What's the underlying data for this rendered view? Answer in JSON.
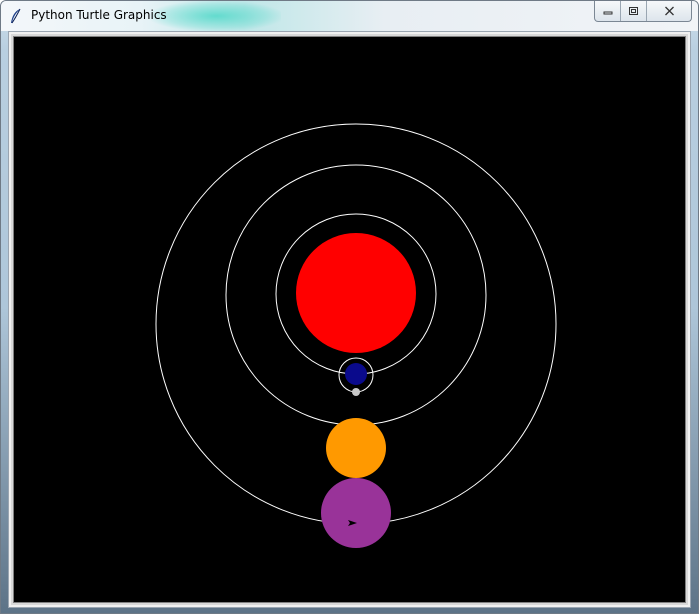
{
  "window": {
    "title": "Python Turtle Graphics",
    "app_icon": "feather-icon",
    "controls": {
      "minimize_icon": "minimize-icon",
      "maximize_icon": "restore-icon",
      "close_icon": "close-icon"
    }
  },
  "canvas": {
    "background": "#000000",
    "orbit_color": "#ffffff",
    "bodies": [
      {
        "name": "sun",
        "color": "#ff0000"
      },
      {
        "name": "earth",
        "color": "#0a0a8c"
      },
      {
        "name": "moon",
        "color": "#c8c8c8"
      },
      {
        "name": "orange-planet",
        "color": "#ff9900"
      },
      {
        "name": "purple-planet",
        "color": "#993399"
      }
    ],
    "turtle_cursor_color": "#000000"
  }
}
